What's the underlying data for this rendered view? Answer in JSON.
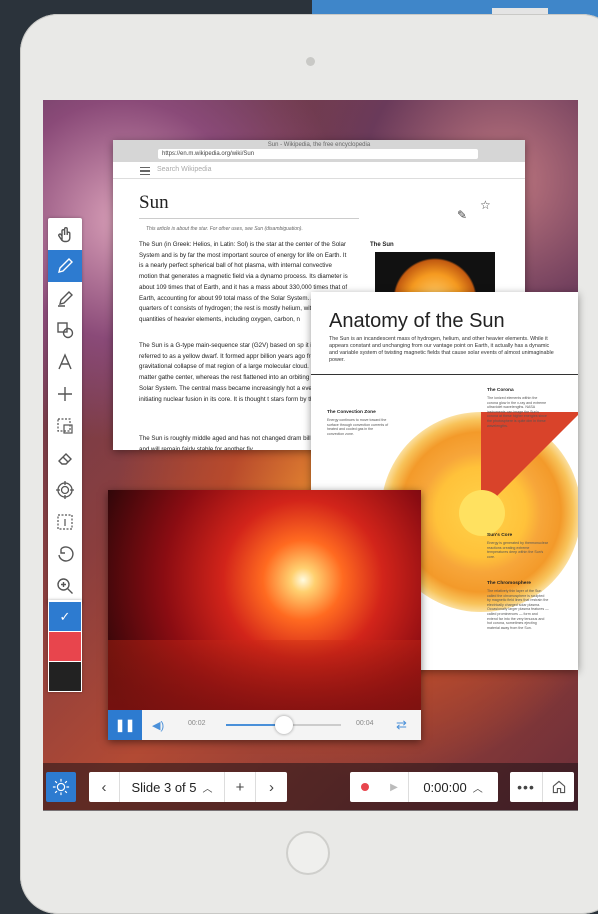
{
  "browser": {
    "window_title": "Sun - Wikipedia, the free encyclopedia",
    "url": "https://en.m.wikipedia.org/wiki/Sun",
    "search_placeholder": "Search Wikipedia"
  },
  "wiki": {
    "title": "Sun",
    "hatnote": "This article is about the star. For other uses, see Sun (disambiguation).",
    "infobox_title": "The Sun",
    "p1": "The Sun (in Greek: Helios, in Latin: Sol) is the star at the center of the Solar System and is by far the most important source of energy for life on Earth. It is a nearly perfect spherical ball of hot plasma, with internal convective motion that generates a magnetic field via a dynamo process. Its diameter is about 109 times that of Earth, and it has a mass about 330,000 times that of Earth, accounting for about 99 total mass of the Solar System. About three quarters of t consists of hydrogen; the rest is mostly helium, with much quantities of heavier elements, including oxygen, carbon, n",
    "p2": "The Sun is a G-type main-sequence star (G2V) based on sp it is informally referred to as a yellow dwarf. It formed appr billion years ago from the gravitational collapse of mat region of a large molecular cloud. Most of this matter gathe center, whereas the rest flattened into an orbiting disk that Solar System. The central mass became increasingly hot a eventually initiating nuclear fusion in its core. It is thought t stars form by this process.",
    "p3": "The Sun is roughly middle aged and has not changed dram billion years, and will remain fairly stable for another fiv"
  },
  "anatomy": {
    "title": "Anatomy of the Sun",
    "intro": "The Sun is an incandescent mass of hydrogen, helium, and other heavier elements. While it appears constant and unchanging from our vantage point on Earth, it actually has a dynamic and variable system of twisting magnetic fields that cause solar events of almost unimaginable power.",
    "labels": {
      "convection_zone": "The Convection Zone",
      "convection_zone_text": "Energy continues to move toward the surface through convection currents of heated and cooled gas in the convection zone.",
      "corona": "The Corona",
      "corona_text": "The ionized elements within the corona glow in the x-ray and extreme ultraviolet wavelengths. NASA instruments can image the Sun's corona at these higher energies since the photosphere is quite dim in these wavelengths.",
      "core": "Sun's Core",
      "core_text": "Energy is generated by thermonuclear reactions creating extreme temperatures deep within the Sun's core.",
      "chromosphere": "The Chromosphere",
      "chromosphere_text": "The relatively thin layer of the Sun called the chromosphere is sculpted by magnetic field lines that restrain the electrically charged solar plasma. Occasionally larger plasma features — called prominences — form and extend far into the very tenuous and hot corona, sometimes ejecting material away from the Sun."
    }
  },
  "video": {
    "current_time": "00:02",
    "end_time": "00:04",
    "progress": 0.5,
    "play_state": "paused"
  },
  "toolbar": {
    "tools": [
      "select-hand-icon",
      "pen-icon",
      "highlighter-icon",
      "shapes-icon",
      "text-icon",
      "plus-icon",
      "screen-capture-icon",
      "eraser-icon",
      "target-icon",
      "text-box-icon",
      "undo-icon",
      "zoom-icon"
    ],
    "active_tool": "pen-icon",
    "colors": [
      "#2d7bd0",
      "#e8454d",
      "#222222"
    ],
    "selected_color": "#2d7bd0",
    "selected_mark": "✓"
  },
  "bottom_bar": {
    "slide_label": "Slide 3 of 5",
    "timer": "0:00:00"
  },
  "colors": {
    "accent": "#2d7bd0",
    "record": "#e8454d"
  }
}
